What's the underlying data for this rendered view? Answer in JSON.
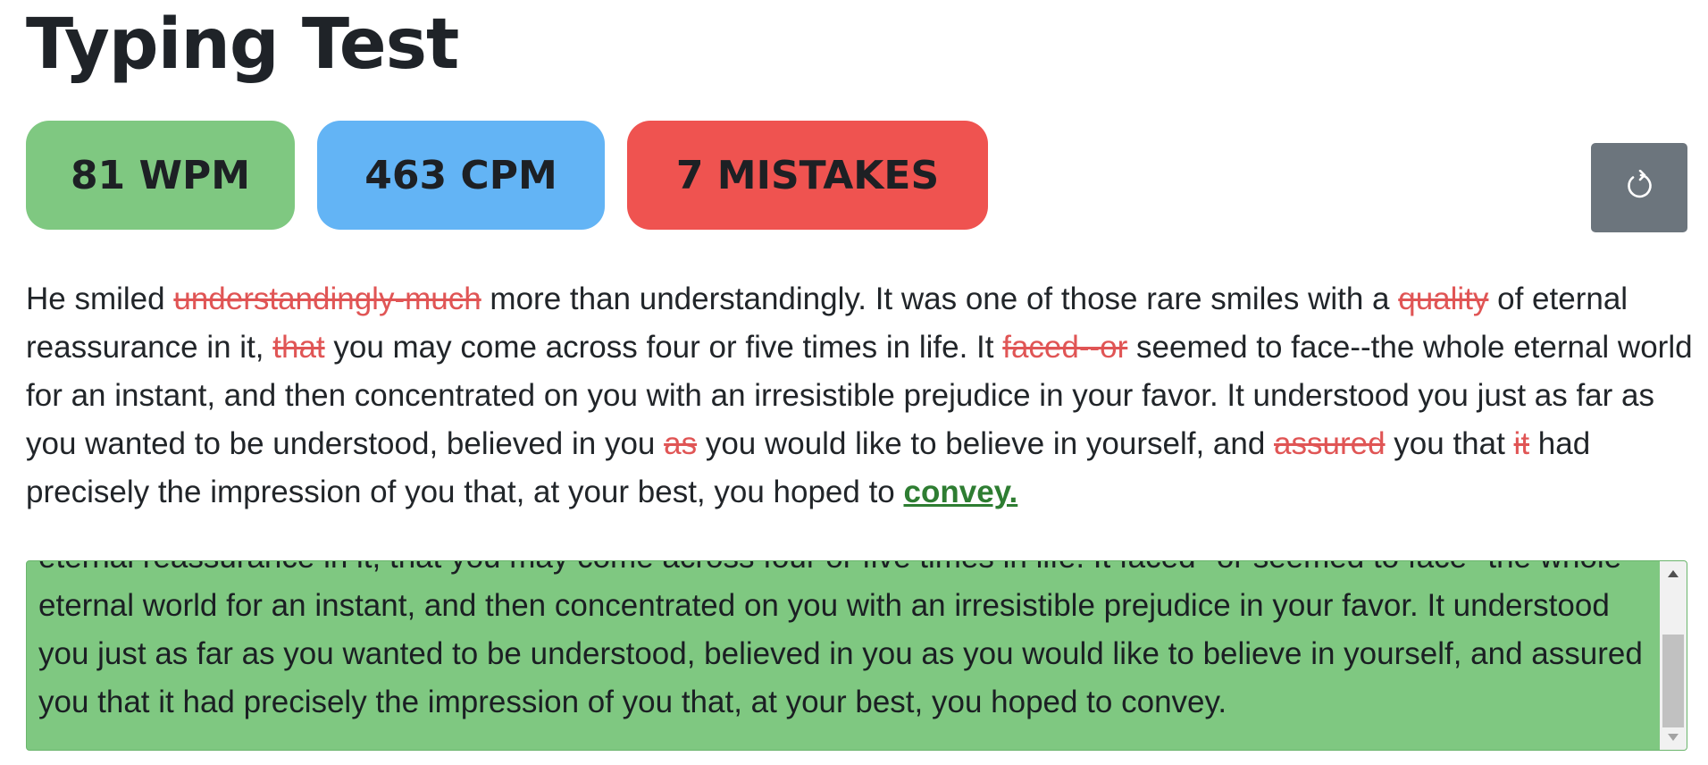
{
  "page": {
    "title": "Typing Test"
  },
  "stats": {
    "wpm": "81 WPM",
    "cpm": "463 CPM",
    "mistakes": "7 MISTAKES"
  },
  "colors": {
    "wpm": "#7fc881",
    "cpm": "#63b4f5",
    "mistakes": "#ef5350",
    "reset_button": "#6c757d",
    "wrong_word": "#e05555",
    "current_word": "#2e7d32"
  },
  "reset_button": {
    "icon": "reset-icon"
  },
  "passage": {
    "segments": [
      {
        "text": "He smiled ",
        "state": "normal"
      },
      {
        "text": "understandingly-much",
        "state": "wrong"
      },
      {
        "text": " more than understandingly. It was one of those rare smiles with a ",
        "state": "normal"
      },
      {
        "text": "quality",
        "state": "wrong"
      },
      {
        "text": " of eternal reassurance in it, ",
        "state": "normal"
      },
      {
        "text": "that",
        "state": "wrong"
      },
      {
        "text": " you may come across four or five times in life. It ",
        "state": "normal"
      },
      {
        "text": "faced--or",
        "state": "wrong"
      },
      {
        "text": " seemed to face--the whole eternal world for an instant, and then concentrated on you with an irresistible prejudice in your favor. It understood you just as far as you wanted to be understood, believed in you ",
        "state": "normal"
      },
      {
        "text": "as",
        "state": "wrong"
      },
      {
        "text": " you would like to believe in yourself, and ",
        "state": "normal"
      },
      {
        "text": "assured",
        "state": "wrong"
      },
      {
        "text": " you that ",
        "state": "normal"
      },
      {
        "text": "it",
        "state": "wrong"
      },
      {
        "text": " had precisely the impression of you that, at your best, you hoped to ",
        "state": "normal"
      },
      {
        "text": "convey.",
        "state": "current"
      }
    ]
  },
  "input": {
    "value": "eternal reassurance in it, that you may come across four or five times in life. It faced--or seemed to face--the whole eternal world for an instant, and then concentrated on you with an irresistible prejudice in your favor. It understood you just as far as you wanted to be understood, believed in you as you would like to believe in yourself, and assured you that it had precisely the impression of you that, at your best, you hoped to convey."
  }
}
